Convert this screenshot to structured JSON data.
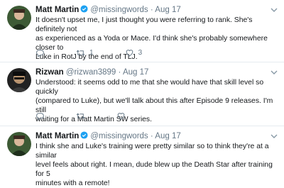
{
  "tweets": [
    {
      "name": "Matt Martin",
      "verified": true,
      "handle": "@missingwords",
      "separator": "·",
      "date": "Aug 17",
      "lines": [
        "It doesn't upset me, I just thought you were referring to rank. She's definitely not",
        "as experienced as a Yoda or Mace. I'd think she's probably somewhere closer to",
        "Luke in RotJ by the end of TLJ."
      ],
      "retweets": "1",
      "likes": "3",
      "avatar_color": "#2f4a2a"
    },
    {
      "name": "Rizwan",
      "verified": false,
      "handle": "@rizwan3899",
      "separator": "·",
      "date": "Aug 17",
      "lines": [
        "Understood: it seems odd to me that she would have that skill level so quickly",
        "(compared to Luke), but we'll talk about this after Episode 9 releases. I'm still",
        "waiting for a Matt Martin SW series."
      ],
      "avatar_color": "#1a1a1a"
    },
    {
      "name": "Matt Martin",
      "verified": true,
      "handle": "@missingwords",
      "separator": "·",
      "date": "Aug 17",
      "lines": [
        "I think she and Luke's training were pretty similar so to think they're at a similar",
        "level feels about right. I mean, dude blew up the Death Star after training for 5",
        "minutes with a remote!"
      ],
      "avatar_color": "#2f4a2a"
    }
  ],
  "colors": {
    "accent": "#1da1f2",
    "muted": "#657786",
    "divider": "#e6ecf0"
  },
  "icons": [
    "chevron-down-icon",
    "reply-icon",
    "retweet-icon",
    "like-icon",
    "verified-icon"
  ]
}
